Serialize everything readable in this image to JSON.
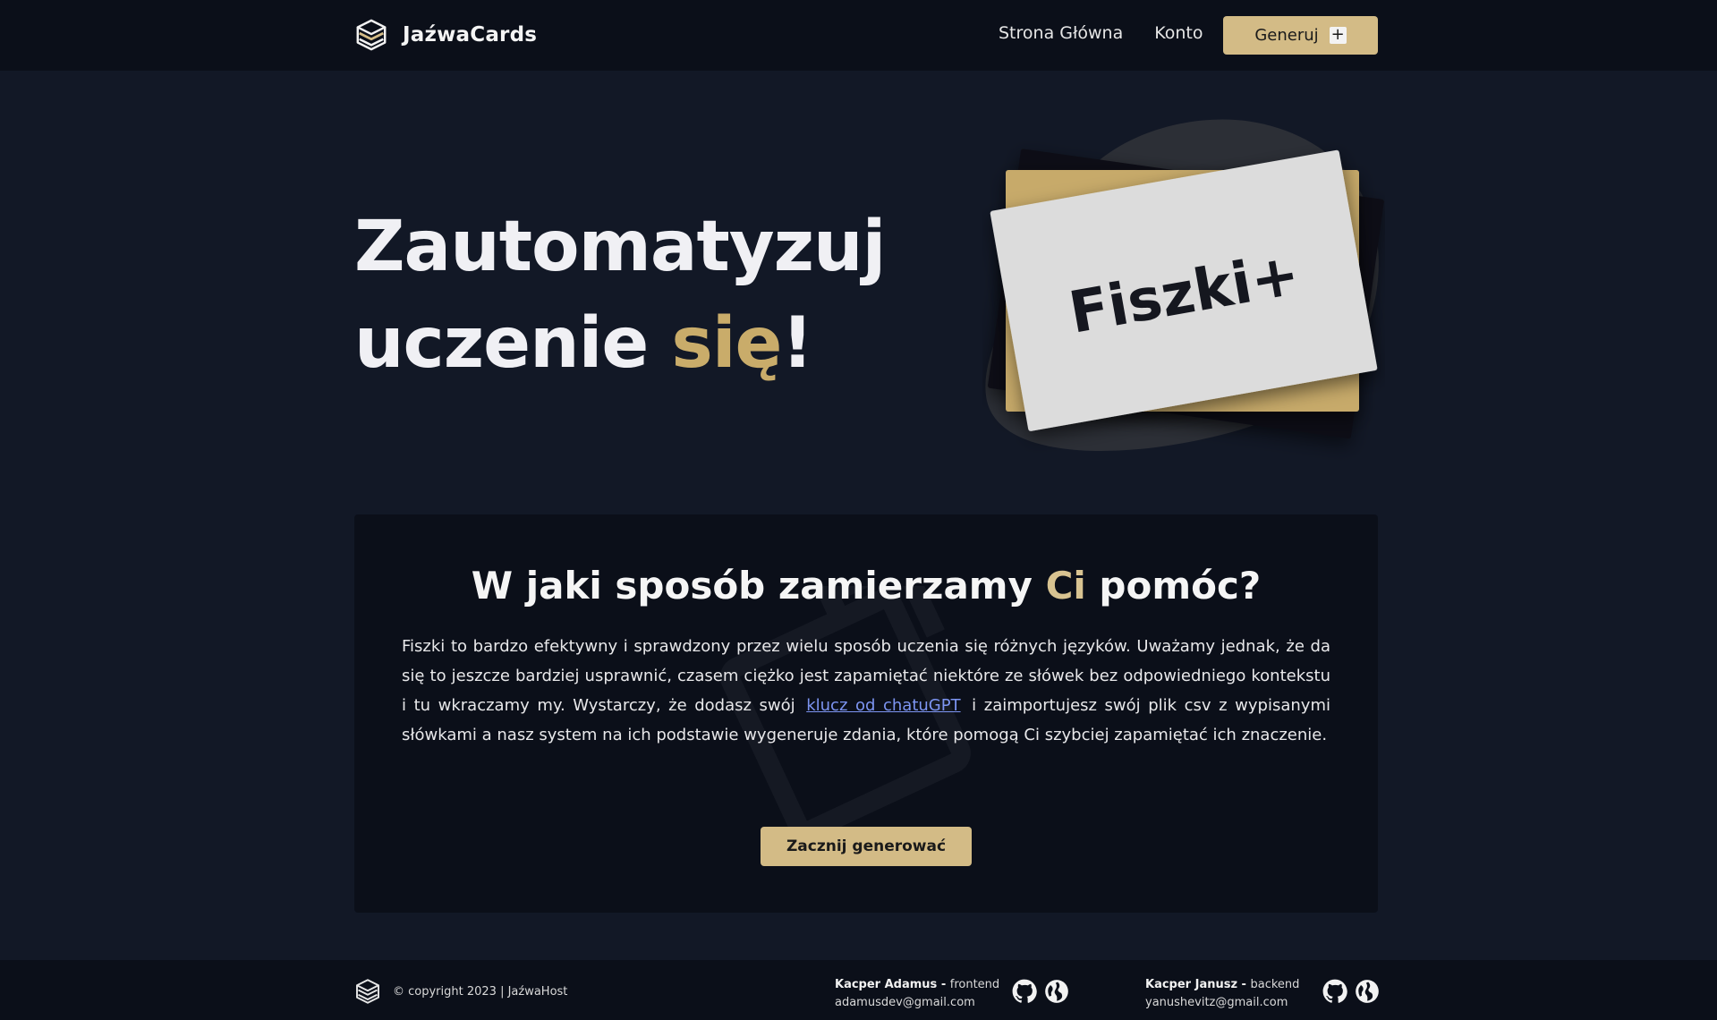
{
  "nav": {
    "brand": "JaźwaCards",
    "links": [
      "Strona Główna",
      "Konto"
    ],
    "generate_label": "Generuj",
    "generate_icon": "plus-icon"
  },
  "hero": {
    "title_line1": "Zautomatyzuj",
    "title_line2_prefix": "uczenie ",
    "title_line2_accent": "się",
    "title_line2_suffix": "!",
    "card_text": "Fiszki+"
  },
  "info": {
    "title_prefix": "W jaki sposób zamierzamy ",
    "title_accent": "Ci",
    "title_suffix": " pomóc?",
    "text_before_link": "Fiszki to bardzo efektywny i sprawdzony przez wielu sposób uczenia się różnych języków. Uważamy jednak, że da się to jeszcze bardziej usprawnić, czasem ciężko jest zapamiętać niektóre ze słówek bez odpowiedniego kontekstu i tu wkraczamy my. Wystarczy, że dodasz swój",
    "link_text": "klucz od chatuGPT",
    "text_after_link": "i zaimportujesz swój plik csv z wypisanymi słówkami a nasz system na ich podstawie wygeneruje zdania, które pomogą Ci szybciej zapamiętać ich znaczenie.",
    "start_button": "Zacznij generować"
  },
  "footer": {
    "copyright": "© copyright 2023 | JaźwaHost",
    "authors": [
      {
        "name": "Kacper Adamus - ",
        "role": "frontend",
        "email": "adamusdev@gmail.com"
      },
      {
        "name": "Kacper Janusz - ",
        "role": "backend",
        "email": "yanushevitz@gmail.com"
      }
    ]
  },
  "colors": {
    "background": "#121826",
    "navbar": "#0b0f19",
    "accent": "#d3bb86",
    "accent_text": "#c9ac6a",
    "link": "#7d95f2"
  },
  "icons": [
    "logo-icon",
    "plus-icon",
    "github-icon",
    "globe-icon"
  ]
}
